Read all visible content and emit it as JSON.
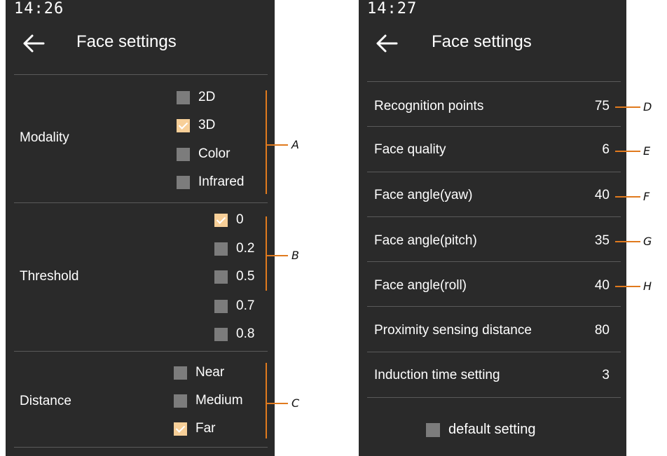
{
  "left_screen": {
    "time": "14:26",
    "title": "Face settings",
    "groups": [
      {
        "label": "Modality",
        "options": [
          {
            "label": "2D",
            "checked": false
          },
          {
            "label": "3D",
            "checked": true
          },
          {
            "label": "Color",
            "checked": false
          },
          {
            "label": "Infrared",
            "checked": false
          }
        ]
      },
      {
        "label": "Threshold",
        "options": [
          {
            "label": "0",
            "checked": true
          },
          {
            "label": "0.2",
            "checked": false
          },
          {
            "label": "0.5",
            "checked": false
          },
          {
            "label": "0.7",
            "checked": false
          },
          {
            "label": "0.8",
            "checked": false
          }
        ]
      },
      {
        "label": "Distance",
        "options": [
          {
            "label": "Near",
            "checked": false
          },
          {
            "label": "Medium",
            "checked": false
          },
          {
            "label": "Far",
            "checked": true
          }
        ]
      }
    ]
  },
  "right_screen": {
    "time": "14:27",
    "title": "Face settings",
    "rows": [
      {
        "label": "Recognition points",
        "value": "75"
      },
      {
        "label": "Face quality",
        "value": "6"
      },
      {
        "label": "Face angle(yaw)",
        "value": "40"
      },
      {
        "label": "Face angle(pitch)",
        "value": "35"
      },
      {
        "label": "Face angle(roll)",
        "value": "40"
      },
      {
        "label": "Proximity sensing distance",
        "value": "80"
      },
      {
        "label": "Induction time setting",
        "value": "3"
      }
    ],
    "default_setting": {
      "label": "default setting",
      "checked": false
    }
  },
  "callouts": {
    "A": "A",
    "B": "B",
    "C": "C",
    "D": "D",
    "E": "E",
    "F": "F",
    "G": "G",
    "H": "H"
  },
  "colors": {
    "screen_bg": "#2a2a2a",
    "checked": "#f7cf98",
    "unchecked": "#7c7c7c",
    "callout_line": "#e07a1e"
  },
  "icons": {
    "back": "arrow-left-icon",
    "checkbox": "checkbox-icon"
  }
}
